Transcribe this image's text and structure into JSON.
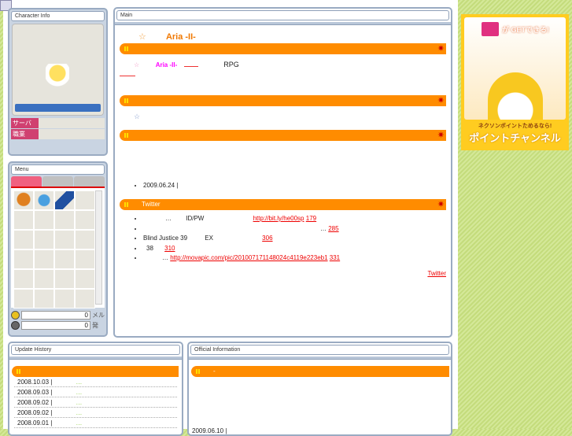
{
  "character": {
    "title": "Character Info",
    "server_label": "サーバ",
    "job_label": "職業"
  },
  "menu": {
    "title": "Menu",
    "meso_value": "0",
    "meso_unit": "メル",
    "bullet_value": "0",
    "bullet_unit": "発"
  },
  "main": {
    "title": "Main",
    "heading_star": "☆",
    "heading": "Aria -II-",
    "intro_star": "☆",
    "intro_name": "Aria -II-",
    "intro_rpg": "RPG",
    "news_star": "☆",
    "news_date": "2009.06.24 |",
    "twitter_bar": "Twitter",
    "tweets": [
      {
        "pre": "…",
        "mid": "ID/PW",
        "link": "http://bit.ly/he00sp",
        "count": "179"
      },
      {
        "pre": "",
        "mid": "…",
        "link": "",
        "count": "285"
      },
      {
        "pre": "Blind Justice 39",
        "mid": "EX",
        "link": "",
        "count": "306"
      },
      {
        "pre": "38",
        "mid": "",
        "link": "",
        "count": "310"
      },
      {
        "pre": "…",
        "mid": "",
        "link": "http://movapic.com/pic/201007171148024c4119e223eb1",
        "count": "331"
      }
    ],
    "twitter_link": "Twitter"
  },
  "updates": {
    "title": "Update History",
    "items": [
      {
        "date": "2008.10.03 |",
        "text": "…"
      },
      {
        "date": "2008.09.03 |",
        "text": "…"
      },
      {
        "date": "2008.09.02 |",
        "text": "…"
      },
      {
        "date": "2008.09.02 |",
        "text": "…"
      },
      {
        "date": "2008.09.01 |",
        "text": "…"
      }
    ]
  },
  "official": {
    "title": "Official Information",
    "bar": "-",
    "date": "2009.06.10 |"
  },
  "banner": {
    "top": "が GETできる!",
    "sub": "ネクソンポイントためるなら!",
    "main": "ポイントチャンネル"
  }
}
